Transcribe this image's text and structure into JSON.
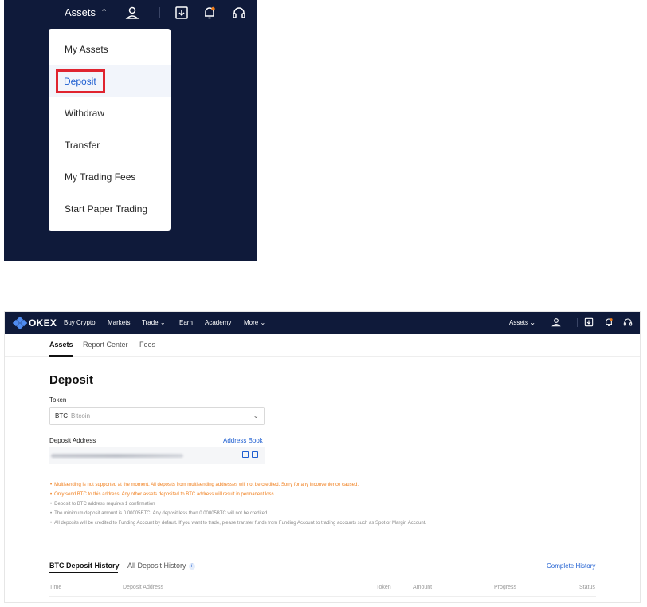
{
  "dropdown_view": {
    "assets_label": "Assets",
    "menu_items": [
      "My Assets",
      "Deposit",
      "Withdraw",
      "Transfer",
      "My Trading Fees",
      "Start Paper Trading"
    ],
    "selected_item": "Deposit"
  },
  "nav": {
    "logo": "OKEX",
    "links": [
      "Buy Crypto",
      "Markets",
      "Trade",
      "Earn",
      "Academy",
      "More"
    ],
    "assets_label": "Assets"
  },
  "subtabs": [
    "Assets",
    "Report Center",
    "Fees"
  ],
  "deposit": {
    "title": "Deposit",
    "token_label": "Token",
    "token_symbol": "BTC",
    "token_name": "Bitcoin",
    "address_label": "Deposit Address",
    "address_book": "Address Book"
  },
  "notes": [
    "Multisending is not supported at the moment. All deposits from multisending addresses will not be credited. Sorry for any inconvenience caused.",
    "Only send BTC to this address. Any other assets deposited to BTC address will result in permanent loss.",
    "Deposit to BTC address requires 1 confirmation",
    "The minimum deposit amount is 0.00005BTC. Any deposit less than 0.00005BTC will not be credited",
    "All deposits will be credited to Funding Account by default. If you want to trade, please transfer funds from Funding Account to trading accounts such as Spot or Margin Account."
  ],
  "history": {
    "tab_btc": "BTC Deposit History",
    "tab_all": "All Deposit History",
    "complete": "Complete History",
    "columns": [
      "Time",
      "Deposit Address",
      "Token",
      "Amount",
      "Progress",
      "Status"
    ]
  },
  "colors": {
    "nav_bg": "#0f1a3a",
    "link_blue": "#1f5fd1",
    "warning_orange": "#f07d1a",
    "highlight_red": "#e0242f"
  }
}
